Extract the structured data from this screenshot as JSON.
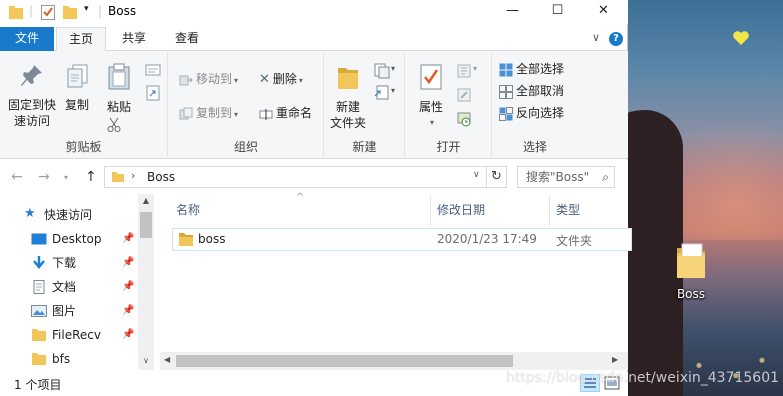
{
  "window": {
    "title": "Boss",
    "controls": {
      "minimize": "—",
      "maximize": "☐",
      "close": "✕"
    }
  },
  "ribbon_tabs": {
    "file": "文件",
    "home": "主页",
    "share": "共享",
    "view": "查看",
    "collapse": "∨"
  },
  "ribbon": {
    "clipboard": {
      "label": "剪贴板",
      "pin_line1": "固定到快",
      "pin_line2": "速访问",
      "copy": "复制",
      "paste": "粘贴"
    },
    "organize": {
      "label": "组织",
      "move_to": "移动到",
      "copy_to": "复制到",
      "delete": "删除",
      "rename": "重命名"
    },
    "new": {
      "label": "新建",
      "new_folder_line1": "新建",
      "new_folder_line2": "文件夹"
    },
    "open": {
      "label": "打开",
      "properties": "属性"
    },
    "select": {
      "label": "选择",
      "select_all": "全部选择",
      "select_none": "全部取消",
      "invert": "反向选择"
    }
  },
  "address": {
    "crumb": "Boss",
    "search_placeholder": "搜索\"Boss\""
  },
  "nav": {
    "quick_access": "快速访问",
    "items": [
      {
        "label": "Desktop",
        "icon": "desktop-icon",
        "pinned": true
      },
      {
        "label": "下载",
        "icon": "download-icon",
        "pinned": true
      },
      {
        "label": "文档",
        "icon": "document-icon",
        "pinned": true
      },
      {
        "label": "图片",
        "icon": "pictures-icon",
        "pinned": true
      },
      {
        "label": "FileRecv",
        "icon": "folder-icon",
        "pinned": true
      },
      {
        "label": "bfs",
        "icon": "folder-icon",
        "pinned": false
      }
    ]
  },
  "file_list": {
    "columns": {
      "name": "名称",
      "modified": "修改日期",
      "type": "类型"
    },
    "rows": [
      {
        "name": "boss",
        "modified": "2020/1/23 17:49",
        "type": "文件夹"
      }
    ]
  },
  "status": {
    "item_count": "1 个项目"
  },
  "desktop": {
    "icon_label": "Boss"
  },
  "watermark": "https://blog.csdn.net/weixin_43715601",
  "colors": {
    "accent": "#1979ca",
    "folder": "#f3c65a",
    "selection_border": "#cde8f7"
  }
}
